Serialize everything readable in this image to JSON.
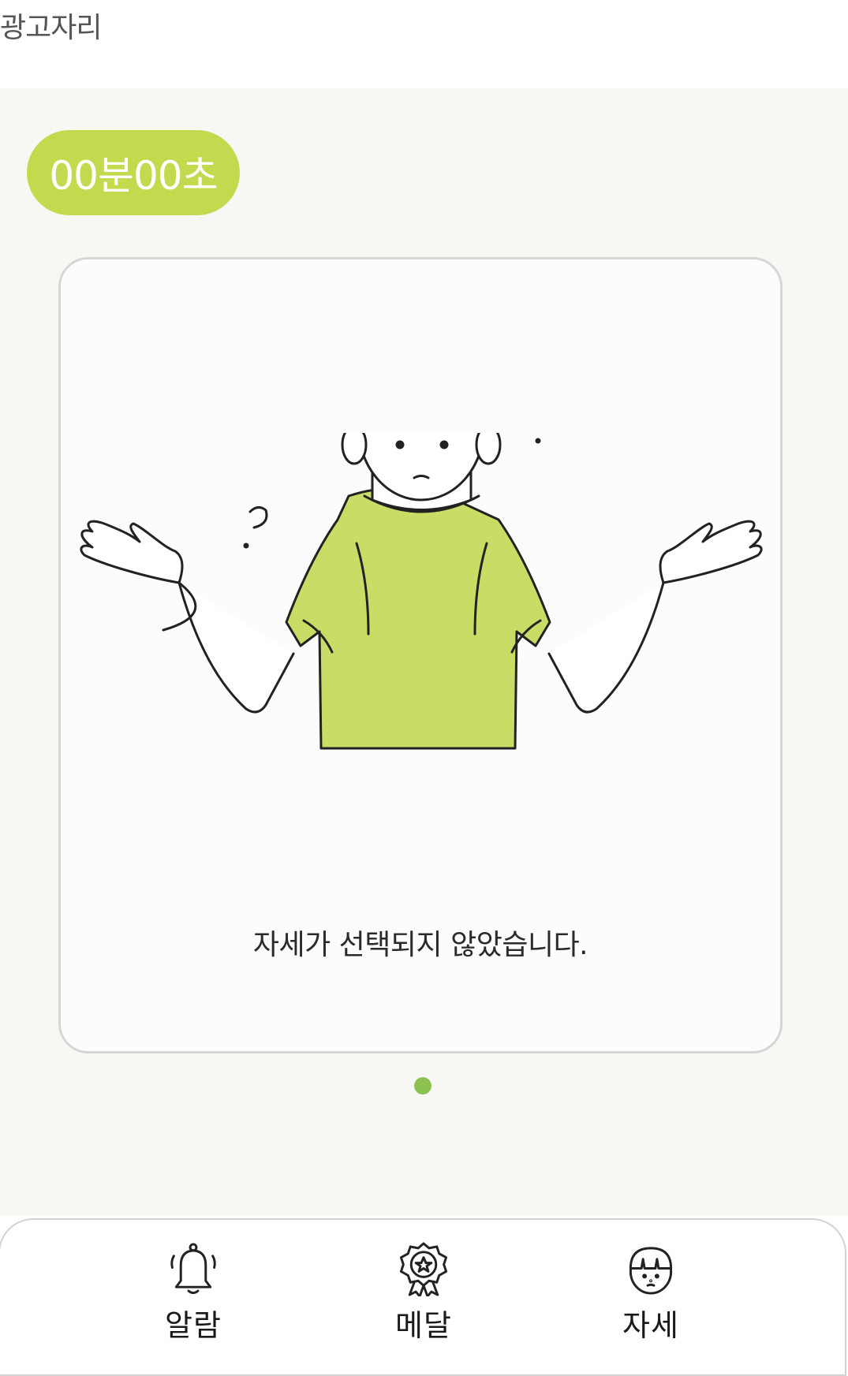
{
  "ad": {
    "label": "광고자리"
  },
  "timer": {
    "display": "00분00초"
  },
  "card": {
    "message": "자세가 선택되지 않았습니다.",
    "illustration": "confused-person-shrugging",
    "shirt_color": "#c8dd66"
  },
  "pager": {
    "count": 1,
    "active": 0,
    "dot_color": "#8cc152"
  },
  "nav": {
    "items": [
      {
        "label": "알람",
        "icon": "bell-icon"
      },
      {
        "label": "메달",
        "icon": "medal-icon"
      },
      {
        "label": "자세",
        "icon": "face-icon"
      }
    ]
  },
  "colors": {
    "accent": "#c5d94e",
    "background": "#f7f7f4",
    "card_border": "#d6d6d6"
  }
}
